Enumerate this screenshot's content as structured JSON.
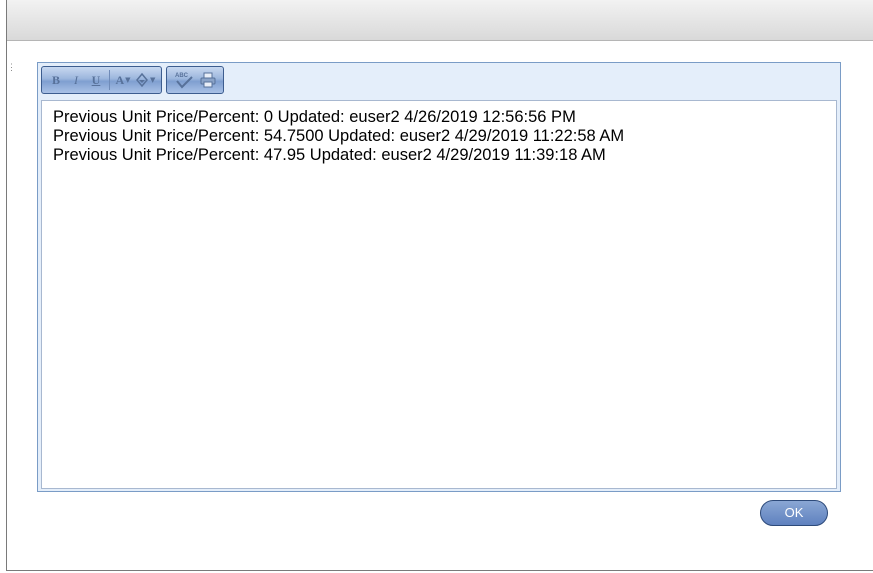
{
  "dialog": {
    "toolbar": {
      "bold_label": "B",
      "italic_label": "I",
      "underline_label": "U",
      "font_color_label": "A",
      "dropdown_arrow": "▼",
      "spellcheck_label": "ABC"
    },
    "content": {
      "lines": [
        "Previous Unit Price/Percent: 0 Updated: euser2 4/26/2019 12:56:56 PM",
        "Previous Unit Price/Percent: 54.7500 Updated: euser2 4/29/2019 11:22:58 AM",
        "Previous Unit Price/Percent: 47.95 Updated: euser2 4/29/2019 11:39:18 AM"
      ]
    },
    "ok_label": "OK"
  },
  "colors": {
    "toolbar_bg": "#e4eefa",
    "button_blue": "#6a8cc6",
    "border_blue": "#7a9cc6"
  },
  "icons": [
    "bold-icon",
    "italic-icon",
    "underline-icon",
    "font-color-icon",
    "highlight-color-icon",
    "spellcheck-icon",
    "print-icon"
  ]
}
